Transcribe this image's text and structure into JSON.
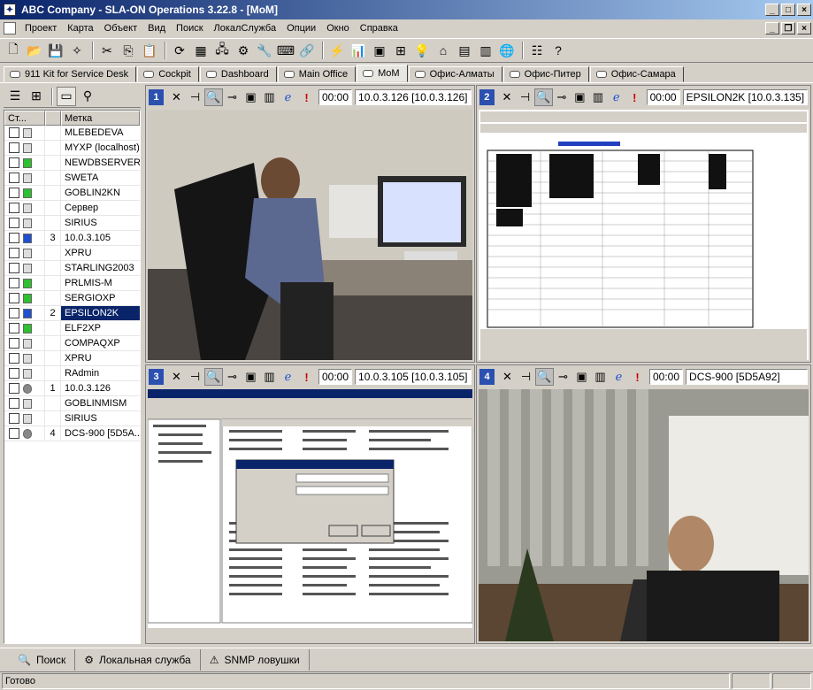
{
  "window": {
    "title": "ABC Company - SLA-ON Operations 3.22.8 - [MoM]"
  },
  "menu": [
    "Проект",
    "Карта",
    "Объект",
    "Вид",
    "Поиск",
    "ЛокалСлужба",
    "Опции",
    "Окно",
    "Справка"
  ],
  "tabs": [
    "911 Kit for Service Desk",
    "Cockpit",
    "Dashboard",
    "Main Office",
    "MoM",
    "Офис-Алматы",
    "Офис-Питер",
    "Офис-Самара"
  ],
  "active_tab": "MoM",
  "grid": {
    "headers": [
      "Ст...",
      "",
      "Метка"
    ],
    "rows": [
      {
        "n": "",
        "name": "MLEBEDEVA",
        "s": "off"
      },
      {
        "n": "",
        "name": "MYXP (localhost)",
        "s": "off"
      },
      {
        "n": "",
        "name": "NEWDBSERVER",
        "s": "on"
      },
      {
        "n": "",
        "name": "SWETA",
        "s": "off"
      },
      {
        "n": "",
        "name": "GOBLIN2KN",
        "s": "on"
      },
      {
        "n": "",
        "name": "Сервер",
        "s": "off"
      },
      {
        "n": "",
        "name": "SIRIUS",
        "s": "off"
      },
      {
        "n": "3",
        "name": "10.0.3.105",
        "s": "blue"
      },
      {
        "n": "",
        "name": "XPRU",
        "s": "off"
      },
      {
        "n": "",
        "name": "STARLING2003",
        "s": "off"
      },
      {
        "n": "",
        "name": "PRLMIS-M",
        "s": "on"
      },
      {
        "n": "",
        "name": "SERGIOXP",
        "s": "on"
      },
      {
        "n": "2",
        "name": "EPSILON2K",
        "s": "blue"
      },
      {
        "n": "",
        "name": "ELF2XP",
        "s": "on"
      },
      {
        "n": "",
        "name": "COMPAQXP",
        "s": "off"
      },
      {
        "n": "",
        "name": "XPRU",
        "s": "off"
      },
      {
        "n": "",
        "name": "RAdmin",
        "s": "off"
      },
      {
        "n": "1",
        "name": "10.0.3.126",
        "s": "cam"
      },
      {
        "n": "",
        "name": "GOBLINMISM",
        "s": "off"
      },
      {
        "n": "",
        "name": "SIRIUS",
        "s": "off"
      },
      {
        "n": "4",
        "name": "DCS-900 [5D5A...",
        "s": "cam"
      }
    ],
    "selected_index": 12
  },
  "panels": [
    {
      "num": "1",
      "time": "00:00",
      "addr": "10.0.3.126 [10.0.3.126]"
    },
    {
      "num": "2",
      "time": "00:00",
      "addr": "EPSILON2K [10.0.3.135]"
    },
    {
      "num": "3",
      "time": "00:00",
      "addr": "10.0.3.105 [10.0.3.105]"
    },
    {
      "num": "4",
      "time": "00:00",
      "addr": "DCS-900 [5D5A92]"
    }
  ],
  "bottom_tabs": [
    "Поиск",
    "Локальная служба",
    "SNMP ловушки"
  ],
  "status": "Готово"
}
